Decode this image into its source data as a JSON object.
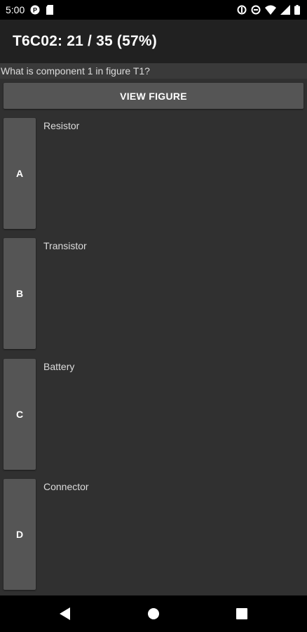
{
  "status": {
    "time": "5:00",
    "icons": [
      "shield-p-icon",
      "sd-card-icon",
      "data-saver-icon",
      "dnd-icon",
      "wifi-icon",
      "signal-icon",
      "battery-icon"
    ]
  },
  "app_bar": {
    "title": "T6C02: 21 / 35 (57%)"
  },
  "question": {
    "text": "What is component 1 in figure T1?"
  },
  "view_figure": {
    "label": "VIEW FIGURE"
  },
  "answers": [
    {
      "letter": "A",
      "text": "Resistor"
    },
    {
      "letter": "B",
      "text": "Transistor"
    },
    {
      "letter": "C",
      "text": "Battery"
    },
    {
      "letter": "D",
      "text": "Connector"
    }
  ],
  "nav": {
    "icons": [
      "back-icon",
      "home-icon",
      "recents-icon"
    ]
  },
  "colors": {
    "background": "#303030",
    "app_bar": "#212121",
    "button": "#555555",
    "status_bar": "#000000"
  }
}
